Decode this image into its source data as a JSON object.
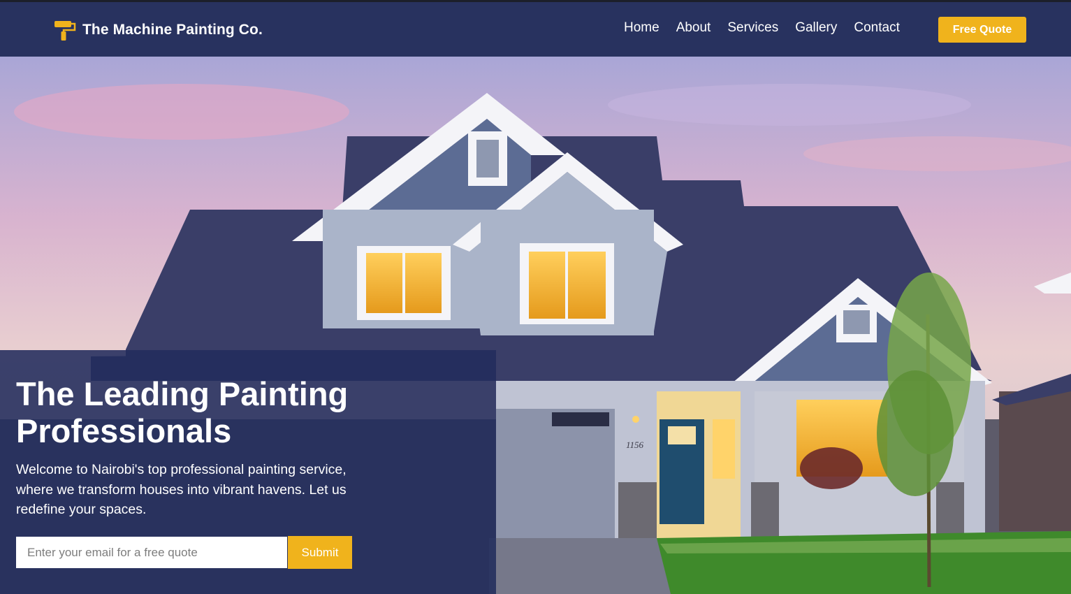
{
  "brand": {
    "name": "The Machine Painting Co.",
    "icon": "paint-roller-icon"
  },
  "nav": {
    "links": [
      {
        "label": "Home"
      },
      {
        "label": "About"
      },
      {
        "label": "Services"
      },
      {
        "label": "Gallery"
      },
      {
        "label": "Contact"
      }
    ],
    "cta_label": "Free Quote"
  },
  "hero": {
    "headline": "The Leading Painting Professionals",
    "subtext": "Welcome to Nairobi's top professional painting service, where we transform houses into vibrant havens. Let us redefine your spaces.",
    "house_number": "1156"
  },
  "form": {
    "placeholder": "Enter your email for a free quote",
    "submit_label": "Submit"
  },
  "colors": {
    "nav_bg": "#28325f",
    "accent": "#f0b31c",
    "overlay": "#222c5c"
  }
}
